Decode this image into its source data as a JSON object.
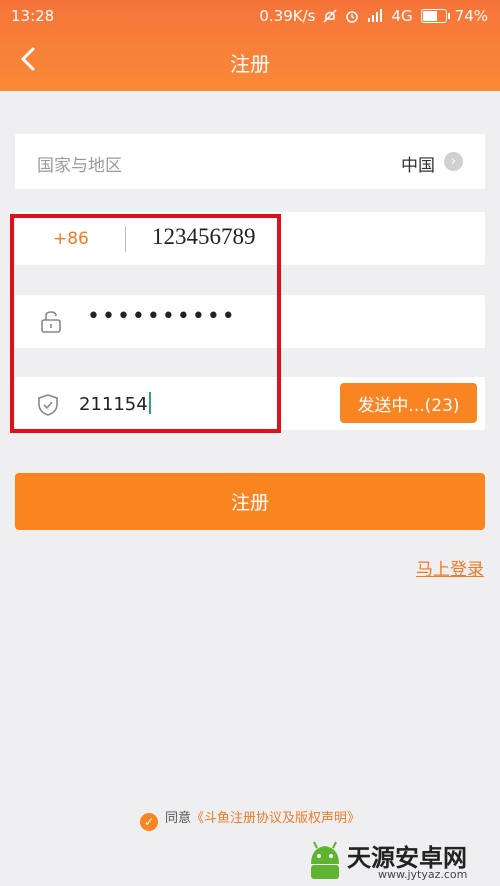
{
  "status_bar": {
    "time": "13:28",
    "speed": "0.39K/s",
    "network": "4G",
    "battery": "74%",
    "battery_level": 0.74
  },
  "header": {
    "title": "注册"
  },
  "form": {
    "region": {
      "label": "国家与地区",
      "value": "中国"
    },
    "phone": {
      "country_code": "+86",
      "value": "123456789"
    },
    "password": {
      "value": "••••••••••"
    },
    "code": {
      "value": "211154",
      "send_label": "发送中...(23)"
    },
    "submit_label": "注册",
    "login_link": "马上登录"
  },
  "agreement": {
    "prefix": "同意",
    "link": "《斗鱼注册协议及版权声明》"
  },
  "watermark": {
    "text": "天源安卓网",
    "url": "www.jytyaz.com"
  }
}
